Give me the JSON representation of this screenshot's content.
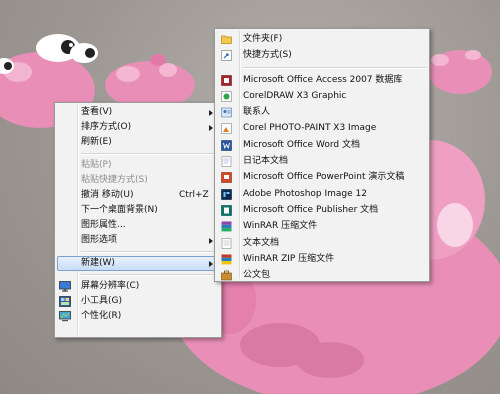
{
  "context_menu": {
    "items": [
      {
        "label": "查看(V)",
        "submenu": true
      },
      {
        "label": "排序方式(O)",
        "submenu": true
      },
      {
        "label": "刷新(E)"
      },
      {
        "label": "粘贴(P)",
        "disabled": true
      },
      {
        "label": "粘贴快捷方式(S)",
        "disabled": true
      },
      {
        "label": "撤消 移动(U)",
        "shortcut": "Ctrl+Z"
      },
      {
        "label": "下一个桌面背景(N)"
      },
      {
        "label": "图形属性..."
      },
      {
        "label": "图形选项",
        "submenu": true
      },
      {
        "label": "新建(W)",
        "submenu": true,
        "highlighted": true
      },
      {
        "label": "屏幕分辨率(C)",
        "icon": "display-icon"
      },
      {
        "label": "小工具(G)",
        "icon": "gadgets-icon"
      },
      {
        "label": "个性化(R)",
        "icon": "personalize-icon"
      }
    ]
  },
  "new_submenu": {
    "items": [
      {
        "label": "文件夹(F)",
        "icon": "folder-icon"
      },
      {
        "label": "快捷方式(S)",
        "icon": "shortcut-icon"
      },
      {
        "label": "Microsoft Office Access 2007 数据库",
        "icon": "access-icon"
      },
      {
        "label": "CorelDRAW X3 Graphic",
        "icon": "coreldraw-icon"
      },
      {
        "label": "联系人",
        "icon": "contact-icon"
      },
      {
        "label": "Corel PHOTO-PAINT X3 Image",
        "icon": "photopaint-icon"
      },
      {
        "label": "Microsoft Office Word 文档",
        "icon": "word-icon"
      },
      {
        "label": "日记本文档",
        "icon": "journal-icon"
      },
      {
        "label": "Microsoft Office PowerPoint 演示文稿",
        "icon": "powerpoint-icon"
      },
      {
        "label": "Adobe Photoshop Image 12",
        "icon": "photoshop-icon"
      },
      {
        "label": "Microsoft Office Publisher 文档",
        "icon": "publisher-icon"
      },
      {
        "label": "WinRAR 压缩文件",
        "icon": "winrar-icon"
      },
      {
        "label": "文本文档",
        "icon": "text-document-icon"
      },
      {
        "label": "WinRAR ZIP 压缩文件",
        "icon": "winrar-zip-icon"
      },
      {
        "label": "公文包",
        "icon": "briefcase-icon"
      }
    ]
  },
  "colors": {
    "menu_bg": "#f2f2f2",
    "highlight": "#c9dcf5",
    "pig_pink": "#ec8fb8"
  }
}
